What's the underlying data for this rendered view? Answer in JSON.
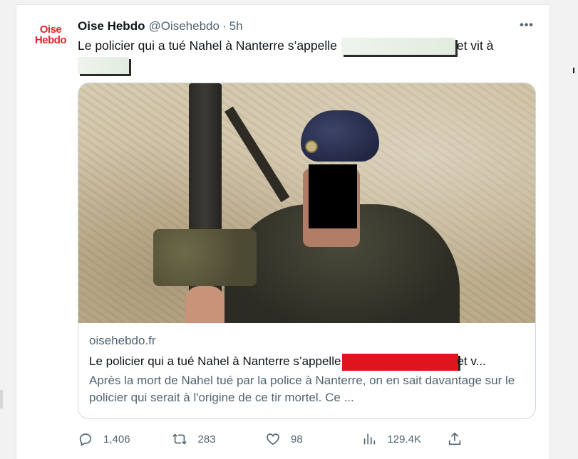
{
  "tweet": {
    "avatar": {
      "line1": "Oise",
      "line2": "Hebdo",
      "color": "#e4252d"
    },
    "display_name": "Oise Hebdo",
    "handle": "@Oisehebdo",
    "separator": "·",
    "time": "5h",
    "more_icon": "more-horizontal-icon",
    "text_part1": "Le policier qui a tué Nahel à Nanterre s’appelle",
    "text_part2": "et vit à"
  },
  "card": {
    "domain": "oisehebdo.fr",
    "title_part1": "Le policier qui a tué Nahel à Nanterre s’appelle",
    "title_part2": "et v...",
    "description": "Après la mort de Nahel tué par la police à Nanterre, on en sait davantage sur le policier qui serait à l'origine de ce tir mortel. Ce ..."
  },
  "actions": {
    "reply": {
      "icon": "reply-icon",
      "count": "1,406"
    },
    "retweet": {
      "icon": "retweet-icon",
      "count": "283"
    },
    "like": {
      "icon": "heart-icon",
      "count": "98"
    },
    "views": {
      "icon": "views-icon",
      "count": "129.4K"
    },
    "share": {
      "icon": "share-icon"
    }
  },
  "colors": {
    "text_primary": "#0f1419",
    "text_secondary": "#536471",
    "border": "#cfd9de",
    "redaction_red": "#e0141e"
  }
}
